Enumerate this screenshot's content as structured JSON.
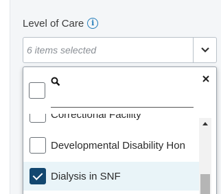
{
  "field": {
    "label": "Level of Care",
    "info_glyph": "i",
    "selected_summary": "6 items selected"
  },
  "dropdown": {
    "search_placeholder": "",
    "items": [
      {
        "label": "Correctional Facility",
        "checked": false
      },
      {
        "label": "Developmental Disability Hon",
        "checked": false
      },
      {
        "label": "Dialysis in SNF",
        "checked": true
      }
    ]
  },
  "colors": {
    "accent": "#1f7ab8",
    "checkbox_checked": "#12476f",
    "selected_row_bg": "#e9f4f8"
  },
  "icons": {
    "info": "info-circle-icon",
    "dropdown": "chevron-down-icon",
    "search": "search-icon",
    "close": "close-icon"
  }
}
